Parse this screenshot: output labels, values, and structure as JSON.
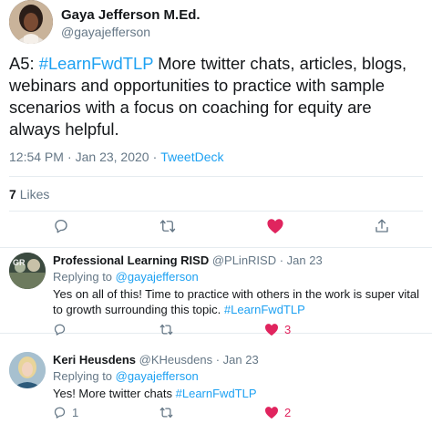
{
  "main_tweet": {
    "author_name": "Gaya Jefferson M.Ed.",
    "author_handle": "@gayajefferson",
    "text_prefix": "A5: ",
    "hashtag": "#LearnFwdTLP",
    "text_rest": " More twitter chats, articles, blogs, webinars and opportunities to practice with sample scenarios with a focus on coaching for equity are always helpful.",
    "time": "12:54 PM",
    "date": "Jan 23, 2020",
    "source": "TweetDeck",
    "likes_count": "7",
    "likes_label": "Likes",
    "liked": true,
    "icons": [
      "reply-icon",
      "retweet-icon",
      "heart-icon",
      "share-icon"
    ]
  },
  "replies": [
    {
      "author_name": "Professional Learning RISD",
      "author_handle": "@PLinRISD",
      "date": "Jan 23",
      "replying_label": "Replying to",
      "replying_to": "@gayajefferson",
      "text": "Yes on all of this! Time to practice with others in the work is super vital to growth surrounding this topic. ",
      "hashtag": "#LearnFwdTLP",
      "reply_count": "",
      "retweet_count": "",
      "like_count": "3"
    },
    {
      "author_name": "Keri Heusdens",
      "author_handle": "@KHeusdens",
      "date": "Jan 23",
      "replying_label": "Replying to",
      "replying_to": "@gayajefferson",
      "text": "Yes! More twitter chats ",
      "hashtag": "#LearnFwdTLP",
      "reply_count": "1",
      "retweet_count": "",
      "like_count": "2"
    }
  ],
  "colors": {
    "link": "#1da1f2",
    "muted": "#657786",
    "like_red": "#e0245e",
    "border": "#e6ecf0"
  }
}
